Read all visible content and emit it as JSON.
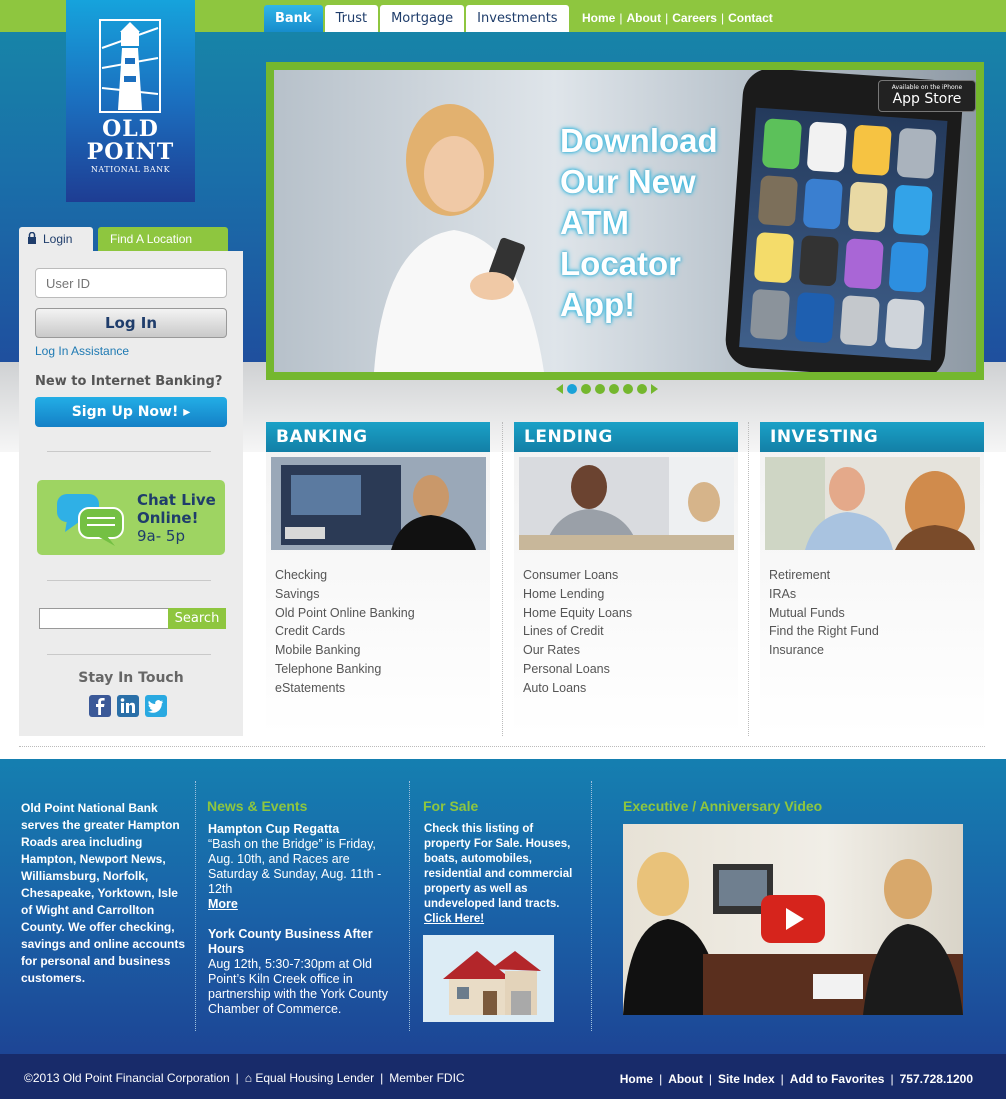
{
  "logo": {
    "line1": "OLD",
    "line2": "POINT",
    "line3": "NATIONAL BANK"
  },
  "tabs": [
    {
      "label": "Bank"
    },
    {
      "label": "Trust"
    },
    {
      "label": "Mortgage"
    },
    {
      "label": "Investments"
    }
  ],
  "top_links": [
    "Home",
    "About",
    "Careers",
    "Contact"
  ],
  "hero": {
    "headline_lines": [
      "Download",
      "Our New",
      "ATM",
      "Locator",
      "App!"
    ],
    "appstore_small": "Available on the iPhone",
    "appstore_label": "App Store",
    "slide_count": 6,
    "active_slide": 1
  },
  "login": {
    "tab_login": "Login",
    "tab_find": "Find A Location",
    "userid_placeholder": "User ID",
    "login_button": "Log In",
    "assistance": "Log In Assistance",
    "new_prompt": "New to Internet Banking?",
    "signup_button": "Sign Up Now!",
    "chat_line1": "Chat Live",
    "chat_line2": "Online!",
    "chat_hours": "9a- 5p",
    "search_button": "Search",
    "stay_in_touch": "Stay In Touch"
  },
  "panels": [
    {
      "title": "BANKING",
      "items": [
        "Checking",
        "Savings",
        "Old Point Online Banking",
        "Credit Cards",
        "Mobile Banking",
        "Telephone Banking",
        "eStatements"
      ]
    },
    {
      "title": "LENDING",
      "items": [
        "Consumer Loans",
        "Home Lending",
        "Home Equity Loans",
        "Lines of Credit",
        "Our Rates",
        "Personal Loans",
        "Auto Loans"
      ]
    },
    {
      "title": "INVESTING",
      "items": [
        "Retirement",
        "IRAs",
        "Mutual Funds",
        "Find the Right Fund",
        "Insurance"
      ]
    }
  ],
  "footer": {
    "about": "Old Point National Bank serves the greater Hampton Roads area including Hampton, Newport News, Williamsburg, Norfolk, Chesapeake, Yorktown, Isle of Wight and Carrollton County. We offer checking, savings and online accounts for personal and business customers.",
    "news_heading": "News & Events",
    "news1_title": "Hampton Cup Regatta",
    "news1_body": "“Bash on the Bridge” is Friday, Aug. 10th, and Races are Saturday & Sunday, Aug. 11th - 12th",
    "news1_more": "More",
    "news2_title": "York County Business After Hours",
    "news2_body": "Aug 12th, 5:30-7:30pm at Old Point’s Kiln Creek office in partnership with the York County Chamber of Commerce.",
    "sale_heading": "For Sale",
    "sale_body": "Check this listing of property For Sale. Houses, boats, automobiles, residential and commercial property as well as undeveloped land tracts.",
    "sale_link": "Click Here!",
    "video_heading": "Executive / Anniversary Video"
  },
  "bottom": {
    "copyright": "©2013 Old Point Financial Corporation",
    "ehl": "Equal Housing Lender",
    "fdic": "Member FDIC",
    "links": [
      "Home",
      "About",
      "Site Index",
      "Add to Favorites"
    ],
    "phone": "757.728.1200"
  },
  "colors": {
    "green": "#8ec63f",
    "blue": "#1784a8",
    "navy": "#182b6a",
    "teal_head": "#1aa1c7"
  }
}
